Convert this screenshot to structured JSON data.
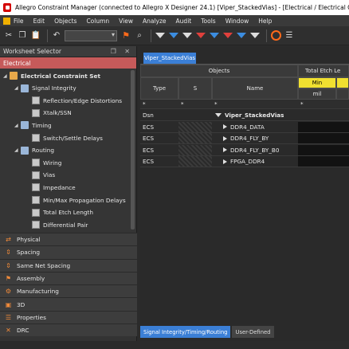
{
  "window": {
    "title": "Allegro Constraint Manager (connected to Allegro X Designer 24.1) [Viper_StackedVias] - [Electrical / Electrical Constraint S"
  },
  "menu": [
    "File",
    "Edit",
    "Objects",
    "Column",
    "View",
    "Analyze",
    "Audit",
    "Tools",
    "Window",
    "Help"
  ],
  "worksheet_selector": {
    "title": "Worksheet Selector",
    "controls": "❐ ✕",
    "section": "Electrical",
    "tree": [
      {
        "label": "Electrical Constraint Set",
        "level": 0,
        "icon": "folder-orange",
        "bold": true,
        "expander": "expanded"
      },
      {
        "label": "Signal Integrity",
        "level": 1,
        "icon": "folder-blue",
        "bold": false,
        "expander": "expanded"
      },
      {
        "label": "Reflection/Edge Distortions",
        "level": 2,
        "icon": "grid",
        "bold": false,
        "expander": ""
      },
      {
        "label": "Xtalk/SSN",
        "level": 2,
        "icon": "grid",
        "bold": false,
        "expander": ""
      },
      {
        "label": "Timing",
        "level": 1,
        "icon": "folder-blue",
        "bold": false,
        "expander": "expanded"
      },
      {
        "label": "Switch/Settle Delays",
        "level": 2,
        "icon": "grid",
        "bold": false,
        "expander": ""
      },
      {
        "label": "Routing",
        "level": 1,
        "icon": "folder-blue",
        "bold": false,
        "expander": "expanded"
      },
      {
        "label": "Wiring",
        "level": 2,
        "icon": "grid",
        "bold": false,
        "expander": ""
      },
      {
        "label": "Vias",
        "level": 2,
        "icon": "grid",
        "bold": false,
        "expander": ""
      },
      {
        "label": "Impedance",
        "level": 2,
        "icon": "grid",
        "bold": false,
        "expander": ""
      },
      {
        "label": "Min/Max Propagation Delays",
        "level": 2,
        "icon": "grid",
        "bold": false,
        "expander": ""
      },
      {
        "label": "Total Etch Length",
        "level": 2,
        "icon": "grid",
        "bold": false,
        "expander": ""
      },
      {
        "label": "Differential Pair",
        "level": 2,
        "icon": "grid",
        "bold": false,
        "expander": ""
      }
    ],
    "workbooks": [
      {
        "label": "Physical",
        "icon": "double-arrow-icon"
      },
      {
        "label": "Spacing",
        "icon": "spacing-icon"
      },
      {
        "label": "Same Net Spacing",
        "icon": "same-net-icon"
      },
      {
        "label": "Assembly",
        "icon": "assembly-icon"
      },
      {
        "label": "Manufacturing",
        "icon": "manufacturing-icon"
      },
      {
        "label": "3D",
        "icon": "3d-icon"
      },
      {
        "label": "Properties",
        "icon": "properties-icon"
      },
      {
        "label": "DRC",
        "icon": "drc-icon"
      }
    ]
  },
  "document": {
    "tab": "Viper_StackedVias",
    "group_header": "Objects",
    "total_etch_header": "Total Etch Le",
    "col_type": "Type",
    "col_s": "S",
    "col_name": "Name",
    "col_min": "Min",
    "col_units": "mil",
    "filter_mark": "*",
    "rows": [
      {
        "type": "Dsn",
        "name": "Viper_StackedVias",
        "expander": "down",
        "bold": true
      },
      {
        "type": "ECS",
        "name": "DDR4_DATA",
        "expander": "right",
        "bold": false
      },
      {
        "type": "ECS",
        "name": "DDR4_FLY_BY",
        "expander": "right",
        "bold": false
      },
      {
        "type": "ECS",
        "name": "DDR4_FLY_BY_B0",
        "expander": "right",
        "bold": false
      },
      {
        "type": "ECS",
        "name": "FPGA_DDR4",
        "expander": "right",
        "bold": false
      }
    ]
  },
  "bottom_tabs": [
    {
      "label": "Signal Integrity/Timing/Routing",
      "active": true
    },
    {
      "label": "User-Defined",
      "active": false
    }
  ],
  "colors": {
    "accent_blue": "#3b7fd6",
    "section_red": "#c65a5a",
    "header_yellow": "#f0e030",
    "toolbar_orange": "#ff6a1a"
  }
}
